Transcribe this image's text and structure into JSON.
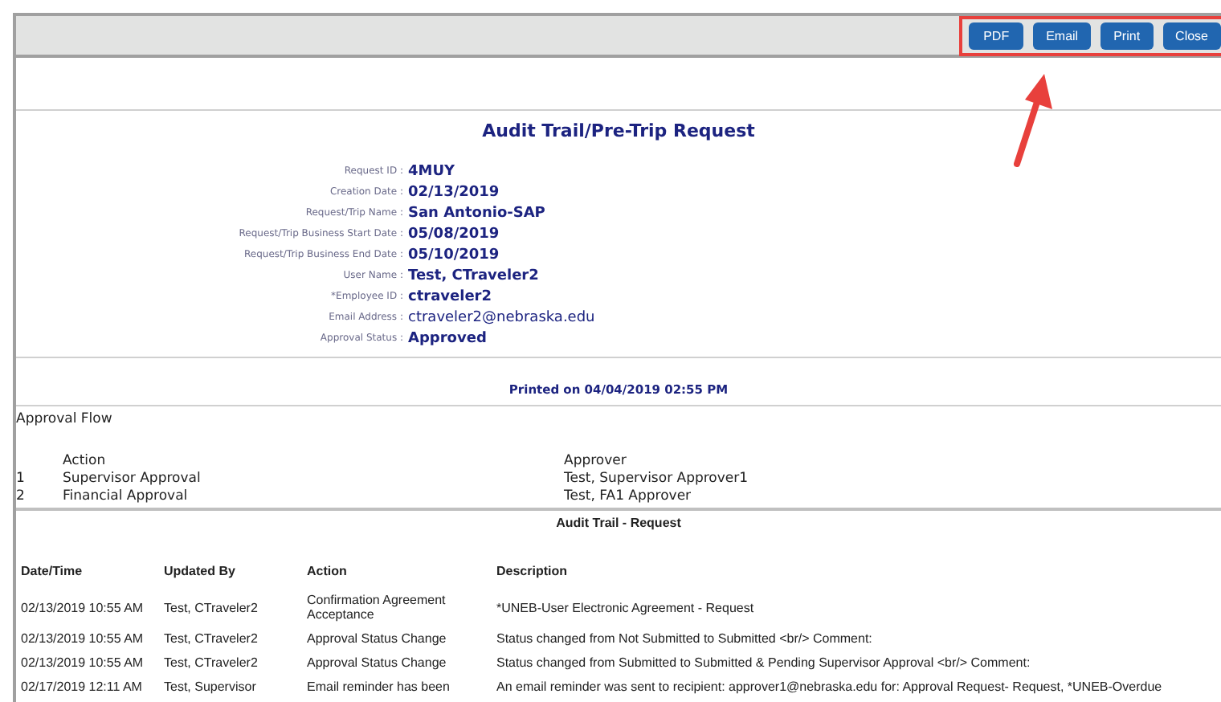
{
  "toolbar": {
    "buttons": [
      "PDF",
      "Email",
      "Print",
      "Close"
    ]
  },
  "title": "Audit Trail/Pre-Trip Request",
  "fields": [
    {
      "label": "Request ID :",
      "value": "4MUY",
      "kind": "strong"
    },
    {
      "label": "Creation Date :",
      "value": "02/13/2019",
      "kind": "strong"
    },
    {
      "label": "Request/Trip Name :",
      "value": "San Antonio-SAP",
      "kind": "strong"
    },
    {
      "label": "Request/Trip Business Start Date :",
      "value": "05/08/2019",
      "kind": "strong"
    },
    {
      "label": "Request/Trip Business End Date :",
      "value": "05/10/2019",
      "kind": "strong"
    },
    {
      "label": "User Name :",
      "value": "Test, CTraveler2",
      "kind": "strong"
    },
    {
      "label": "*Employee ID :",
      "value": "ctraveler2",
      "kind": "strong"
    },
    {
      "label": "Email Address :",
      "value": "ctraveler2@nebraska.edu",
      "kind": "regular"
    },
    {
      "label": "Approval Status :",
      "value": "Approved",
      "kind": "strong"
    }
  ],
  "printed_on": "Printed on 04/04/2019 02:55 PM",
  "approval_flow": {
    "title": "Approval Flow",
    "columns": [
      "Action",
      "Approver"
    ],
    "rows": [
      {
        "number": "1",
        "action": "Supervisor Approval",
        "approver": "Test, Supervisor Approver1"
      },
      {
        "number": "2",
        "action": "Financial Approval",
        "approver": "Test, FA1 Approver"
      }
    ]
  },
  "audit_trail": {
    "title": "Audit Trail - Request",
    "columns": [
      "Date/Time",
      "Updated By",
      "Action",
      "Description"
    ],
    "rows": [
      [
        "02/13/2019 10:55 AM",
        "Test, CTraveler2",
        "Confirmation Agreement Acceptance",
        "*UNEB-User Electronic Agreement - Request"
      ],
      [
        "02/13/2019 10:55 AM",
        "Test, CTraveler2",
        "Approval Status Change",
        "Status changed from Not Submitted to Submitted <br/> Comment:"
      ],
      [
        "02/13/2019 10:55 AM",
        "Test, CTraveler2",
        "Approval Status Change",
        "Status changed from Submitted to Submitted & Pending Supervisor Approval <br/> Comment:"
      ],
      [
        "02/17/2019 12:11 AM",
        "Test, Supervisor",
        "Email reminder has been",
        "An email reminder was sent to recipient: approver1@nebraska.edu for: Approval Request- Request, *UNEB-Overdue"
      ]
    ]
  }
}
